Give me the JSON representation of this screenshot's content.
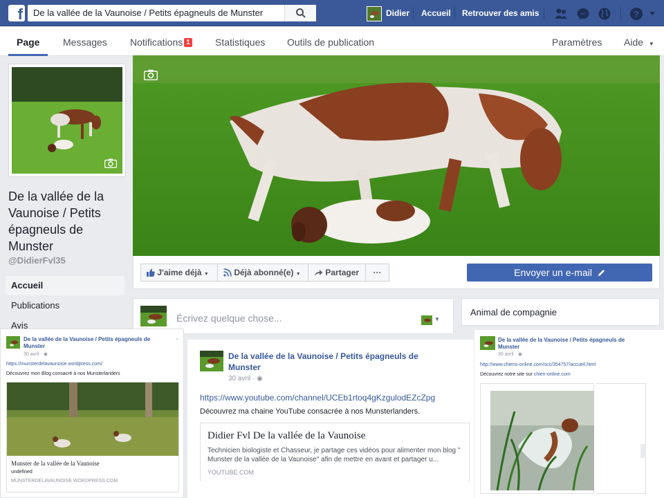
{
  "topbar": {
    "search_value": "De la vallée de la Vaunoise / Petits épagneuls de Munster",
    "user_name": "Didier",
    "home_label": "Accueil",
    "find_friends_label": "Retrouver des amis"
  },
  "page_nav": {
    "tabs": [
      {
        "label": "Page"
      },
      {
        "label": "Messages"
      },
      {
        "label": "Notifications"
      },
      {
        "label": "Statistiques"
      },
      {
        "label": "Outils de publication"
      }
    ],
    "notifications_count": "1",
    "settings_label": "Paramètres",
    "help_label": "Aide"
  },
  "profile": {
    "name": "De la vallée de la Vaunoise / Petits épagneuls de Munster",
    "handle": "@DidierFvl35"
  },
  "left_nav": {
    "items": [
      {
        "label": "Accueil"
      },
      {
        "label": "Publications"
      },
      {
        "label": "Avis"
      }
    ]
  },
  "actions": {
    "like_label": "J'aime déjà",
    "follow_label": "Déjà abonné(e)",
    "share_label": "Partager",
    "more_label": "···",
    "email_label": "Envoyer un e-mail"
  },
  "composer": {
    "placeholder": "Écrivez quelque chose..."
  },
  "side": {
    "category_title": "Animal de compagnie"
  },
  "posts": {
    "left": {
      "page_name": "De la vallée de la Vaunoise / Petits épagneuls de Munster",
      "date": "30 avril",
      "link": "https://munsterdelavaunoise.wordpress.com/",
      "text": "Découvrez mon Blog consacré à nos Munsterlanders",
      "preview_title": "Munster de la vallée de la Vaunoise",
      "preview_sub": "undefined",
      "preview_domain": "MUNSTERDELAVAUNOISE.WORDPRESS.COM"
    },
    "center": {
      "page_name": "De la vallée de la Vaunoise / Petits épagneuls de Munster",
      "date": "30 avril",
      "link": "https://www.youtube.com/channel/UCEb1rtoq4gKzgulodEZcZpg",
      "text": "Découvrez ma chaine YouTube consacrée à nos Munsterlanders.",
      "preview_title": "Didier Fvl De la vallée de la Vaunoise",
      "preview_desc": "Technicien biologiste et Chasseur, je partage ces vidéos pour alimenter mon blog \" Munster de la vallée de la Vaunoise\" afin de mettre en avant et partager u...",
      "preview_domain": "YOUTUBE.COM"
    },
    "right": {
      "page_name": "De la vallée de la Vaunoise / Petits épagneuls de Munster",
      "date": "30 avril",
      "link": "http://www.chiens-online.com/scc/354757/accueil.html",
      "text_prefix": "Découvrez notre site sur",
      "text_link": "chien-online.com"
    }
  },
  "colors": {
    "brand_blue": "#3b5998",
    "button_blue": "#4267b2",
    "link_blue": "#365899",
    "badge_red": "#fa3e3e"
  }
}
